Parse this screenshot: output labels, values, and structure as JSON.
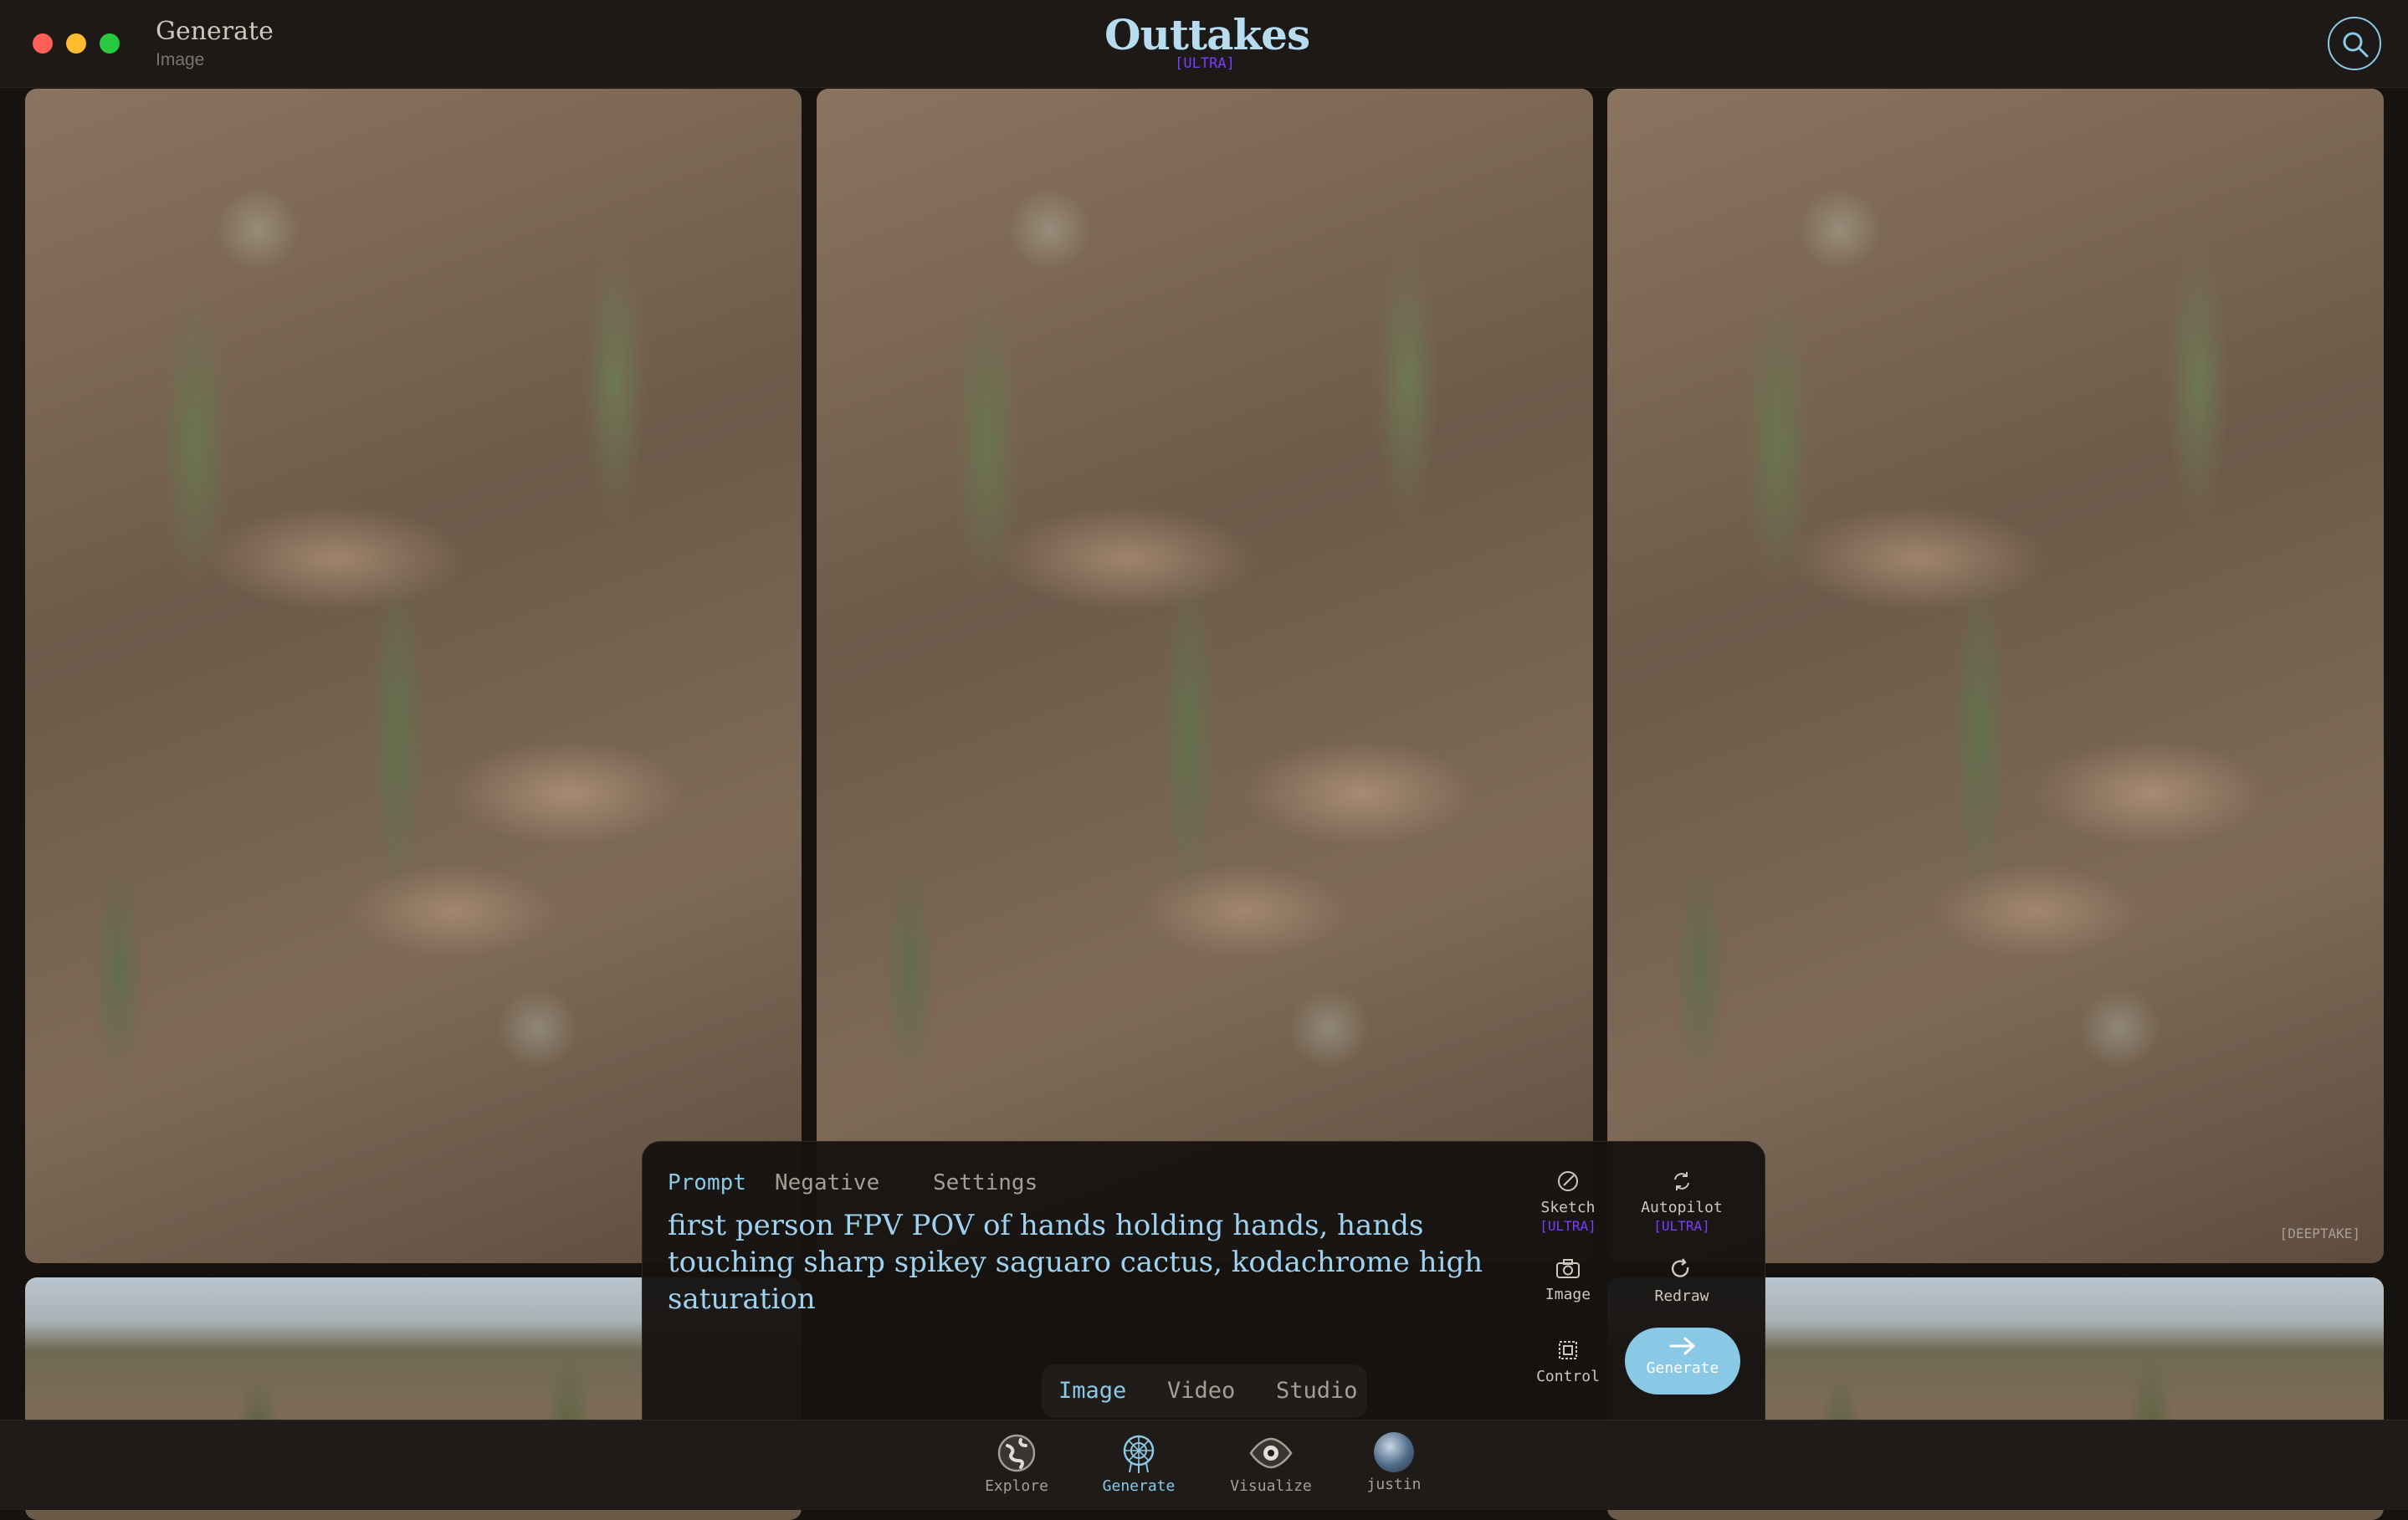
{
  "window": {
    "title": "Generate",
    "subtitle": "Image"
  },
  "logo": {
    "name": "Outtakes",
    "badge": "[ULTRA]"
  },
  "watermark": "[DEEPTAKE]",
  "prompt_panel": {
    "tabs": [
      "Prompt",
      "Negative",
      "Settings"
    ],
    "active_tab": "Prompt",
    "prompt_text": "first person FPV POV of hands holding hands, hands touching sharp spikey saguaro cactus, kodachrome high saturation",
    "tools": {
      "sketch": {
        "label": "Sketch",
        "badge": "[ULTRA]",
        "icon": "pencil-circle-icon"
      },
      "autopilot": {
        "label": "Autopilot",
        "badge": "[ULTRA]",
        "icon": "refresh-cycle-icon"
      },
      "image": {
        "label": "Image",
        "icon": "camera-icon"
      },
      "redraw": {
        "label": "Redraw",
        "icon": "redo-icon"
      },
      "control": {
        "label": "Control",
        "icon": "frame-icon"
      }
    },
    "generate_label": "Generate",
    "modes": [
      "Image",
      "Video",
      "Studio"
    ],
    "active_mode": "Image"
  },
  "dock": {
    "items": [
      {
        "label": "Explore",
        "icon": "globe-icon"
      },
      {
        "label": "Generate",
        "icon": "dreamcatcher-icon"
      },
      {
        "label": "Visualize",
        "icon": "eye-icon"
      },
      {
        "label": "justin",
        "icon": "avatar"
      }
    ],
    "active": "Generate"
  },
  "colors": {
    "accent": "#8ac9e6",
    "ultra_badge": "#7b3cff",
    "background": "#151210"
  }
}
